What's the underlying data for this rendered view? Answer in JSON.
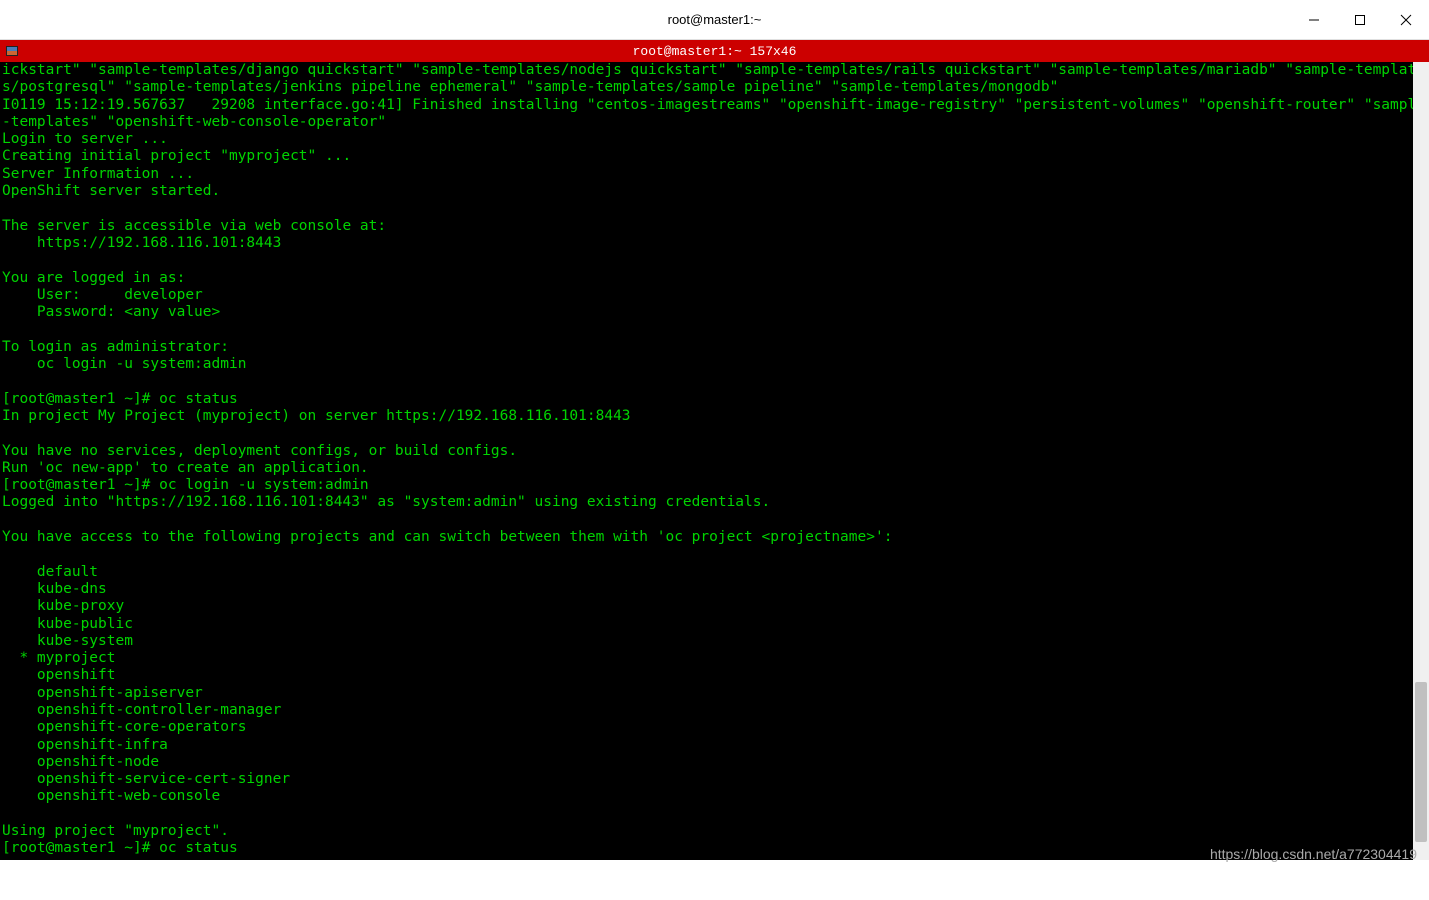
{
  "titlebar": {
    "title": "root@master1:~"
  },
  "tab": {
    "title": "root@master1:~ 157x46"
  },
  "terminal": {
    "lines": [
      "ickstart\" \"sample-templates/django quickstart\" \"sample-templates/nodejs quickstart\" \"sample-templates/rails quickstart\" \"sample-templates/mariadb\" \"sample-templates/postgresql\" \"sample-templates/jenkins pipeline ephemeral\" \"sample-templates/sample pipeline\" \"sample-templates/mongodb\"",
      "I0119 15:12:19.567637   29208 interface.go:41] Finished installing \"centos-imagestreams\" \"openshift-image-registry\" \"persistent-volumes\" \"openshift-router\" \"sample-templates\" \"openshift-web-console-operator\"",
      "Login to server ...",
      "Creating initial project \"myproject\" ...",
      "Server Information ...",
      "OpenShift server started.",
      "",
      "The server is accessible via web console at:",
      "    https://192.168.116.101:8443",
      "",
      "You are logged in as:",
      "    User:     developer",
      "    Password: <any value>",
      "",
      "To login as administrator:",
      "    oc login -u system:admin",
      "",
      "[root@master1 ~]# oc status",
      "In project My Project (myproject) on server https://192.168.116.101:8443",
      "",
      "You have no services, deployment configs, or build configs.",
      "Run 'oc new-app' to create an application.",
      "[root@master1 ~]# oc login -u system:admin",
      "Logged into \"https://192.168.116.101:8443\" as \"system:admin\" using existing credentials.",
      "",
      "You have access to the following projects and can switch between them with 'oc project <projectname>':",
      "",
      "    default",
      "    kube-dns",
      "    kube-proxy",
      "    kube-public",
      "    kube-system",
      "  * myproject",
      "    openshift",
      "    openshift-apiserver",
      "    openshift-controller-manager",
      "    openshift-core-operators",
      "    openshift-infra",
      "    openshift-node",
      "    openshift-service-cert-signer",
      "    openshift-web-console",
      "",
      "Using project \"myproject\".",
      "[root@master1 ~]# oc status"
    ]
  },
  "watermark": "https://blog.csdn.net/a772304419"
}
